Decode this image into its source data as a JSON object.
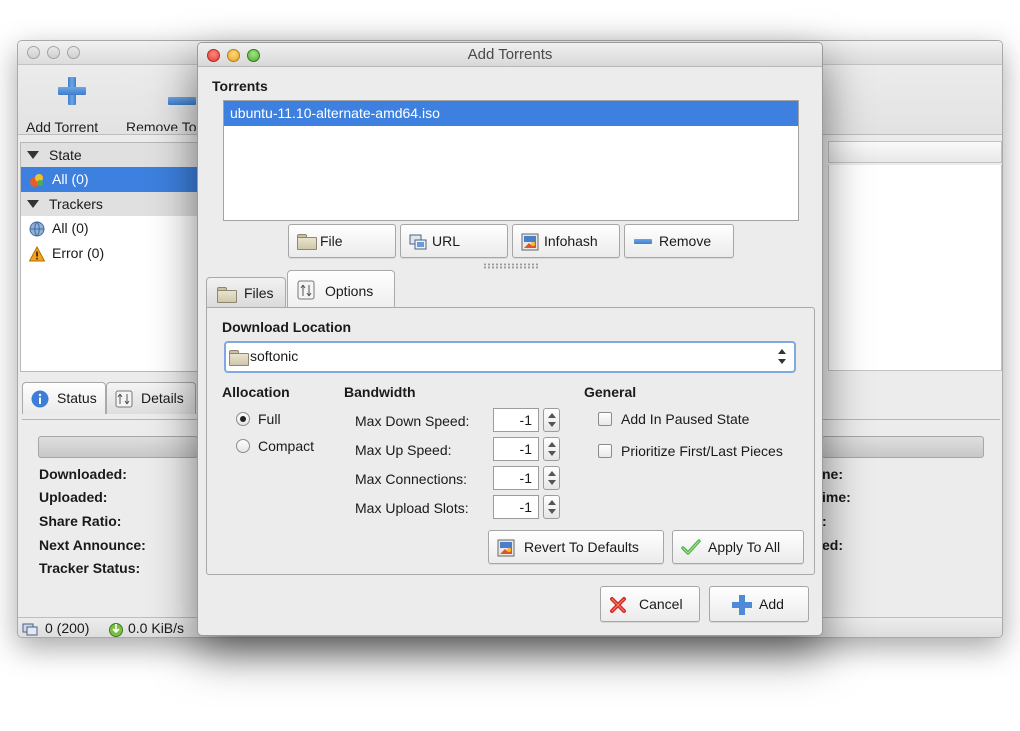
{
  "main_window": {
    "toolbar": {
      "add_torrent": "Add Torrent",
      "remove_torrent": "Remove To"
    },
    "sidebar": {
      "state_header": "State",
      "state_items": [
        {
          "label": "All (0)",
          "icon": "all-states-icon",
          "selected": true
        }
      ],
      "trackers_header": "Trackers",
      "tracker_items": [
        {
          "label": "All (0)",
          "icon": "globe-icon"
        },
        {
          "label": "Error (0)",
          "icon": "warning-icon"
        }
      ]
    },
    "tabs": {
      "status": "Status",
      "details": "Details"
    },
    "status_fields": {
      "downloaded": "Downloaded:",
      "uploaded": "Uploaded:",
      "share_ratio": "Share Ratio:",
      "next_announce": "Next Announce:",
      "tracker_status": "Tracker Status:"
    },
    "right_fields": [
      "ne:",
      "ime:",
      ":",
      "ed:"
    ],
    "statusbar": {
      "connections": "0 (200)",
      "download_speed": "0.0 KiB/s"
    }
  },
  "dialog": {
    "title": "Add Torrents",
    "torrents_label": "Torrents",
    "torrents": [
      {
        "name": "ubuntu-11.10-alternate-amd64.iso",
        "selected": true
      }
    ],
    "source_buttons": {
      "file": "File",
      "url": "URL",
      "infohash": "Infohash",
      "remove": "Remove"
    },
    "tabs": {
      "files": "Files",
      "options": "Options"
    },
    "download_location_label": "Download Location",
    "download_location_value": "softonic",
    "allocation": {
      "label": "Allocation",
      "full": "Full",
      "compact": "Compact",
      "selected": "Full"
    },
    "bandwidth": {
      "label": "Bandwidth",
      "max_down_label": "Max Down Speed:",
      "max_down_value": "-1",
      "max_up_label": "Max Up Speed:",
      "max_up_value": "-1",
      "max_conn_label": "Max Connections:",
      "max_conn_value": "-1",
      "max_slots_label": "Max Upload Slots:",
      "max_slots_value": "-1"
    },
    "general": {
      "label": "General",
      "add_paused": "Add In Paused State",
      "prioritize": "Prioritize First/Last Pieces"
    },
    "option_buttons": {
      "revert": "Revert To Defaults",
      "apply_all": "Apply To All"
    },
    "footer": {
      "cancel": "Cancel",
      "add": "Add"
    },
    "colors": {
      "selection": "#3d80df",
      "close": "#e23a2f",
      "minimize": "#e6a51d",
      "maximize": "#4cae2b"
    }
  }
}
